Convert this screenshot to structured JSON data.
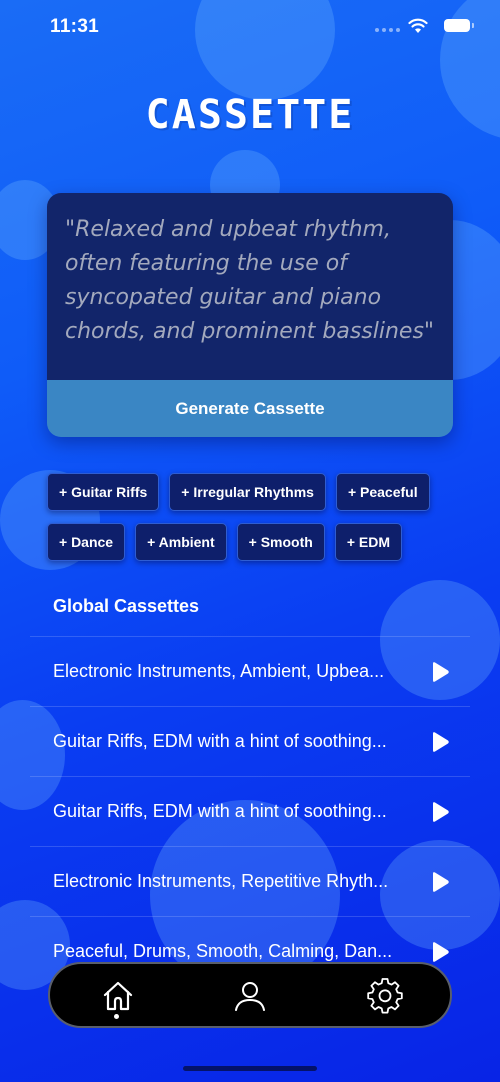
{
  "status_bar": {
    "time": "11:31"
  },
  "app": {
    "logo_text": "CASSETTE"
  },
  "prompt": {
    "text": "\"Relaxed and upbeat rhythm, often featuring the use of syncopated guitar and piano chords, and prominent basslines\"",
    "generate_label": "Generate Cassette"
  },
  "chips": {
    "row1": [
      "+ Guitar Riffs",
      "+ Irregular Rhythms",
      "+ Peaceful"
    ],
    "row2": [
      "+ Dance",
      "+ Ambient",
      "+ Smooth",
      "+ EDM"
    ]
  },
  "global_cassettes": {
    "title": "Global Cassettes",
    "items": [
      "Electronic Instruments, Ambient, Upbea...",
      "Guitar Riffs, EDM with a hint of soothing...",
      "Guitar Riffs, EDM with a hint of soothing...",
      "Electronic Instruments, Repetitive Rhyth...",
      "Peaceful, Drums, Smooth, Calming, Dan..."
    ]
  },
  "tab_bar": {
    "tabs": [
      "home-icon",
      "profile-icon",
      "settings-icon"
    ],
    "active": "home"
  }
}
